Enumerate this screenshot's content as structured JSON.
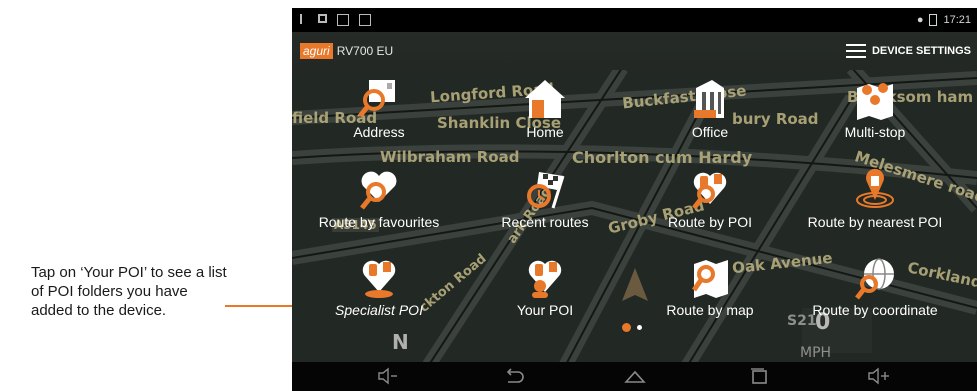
{
  "callout": {
    "text": "Tap on ‘Your POI’ to see a list of POI folders you have added to the device.",
    "color": "#e8782a"
  },
  "status_bar": {
    "time": "17:21"
  },
  "header": {
    "logo": "aguri",
    "model": "RV700 EU",
    "settings_label": "DEVICE SETTINGS"
  },
  "map": {
    "streets": [
      "Longford Road",
      "Buckfast Close",
      "Branksom ham Ro",
      "field Road",
      "Shanklin Close",
      "bury Road",
      "Wilbraham Road",
      "Chorlton cum Hardy",
      "Melesmere road",
      "A5145",
      "Groby Road",
      "Oak Avenue",
      "Corkland",
      "ckton Road",
      "ark Road",
      "N",
      "S21",
      "0",
      "MPH"
    ]
  },
  "menu": {
    "items": [
      {
        "label": "Address",
        "icon": "address-search-icon"
      },
      {
        "label": "Home",
        "icon": "home-icon"
      },
      {
        "label": "Office",
        "icon": "office-building-icon"
      },
      {
        "label": "Multi-stop",
        "icon": "multi-stop-map-icon"
      },
      {
        "label": "Route by favourites",
        "icon": "favourites-heart-icon"
      },
      {
        "label": "Recent routes",
        "icon": "recent-routes-flag-icon"
      },
      {
        "label": "Route by POI",
        "icon": "poi-icon"
      },
      {
        "label": "Route by nearest POI",
        "icon": "nearest-poi-target-icon"
      },
      {
        "label": "Specialist POI",
        "icon": "specialist-poi-icon"
      },
      {
        "label": "Your POI",
        "icon": "your-poi-icon"
      },
      {
        "label": "Route by map",
        "icon": "map-search-icon"
      },
      {
        "label": "Route by coordinate",
        "icon": "globe-search-icon"
      }
    ]
  },
  "pager": {
    "pages": 2,
    "current": 1
  },
  "navbar": [
    "volume-down-icon",
    "back-icon",
    "home-nav-icon",
    "recent-apps-icon",
    "volume-up-icon"
  ]
}
